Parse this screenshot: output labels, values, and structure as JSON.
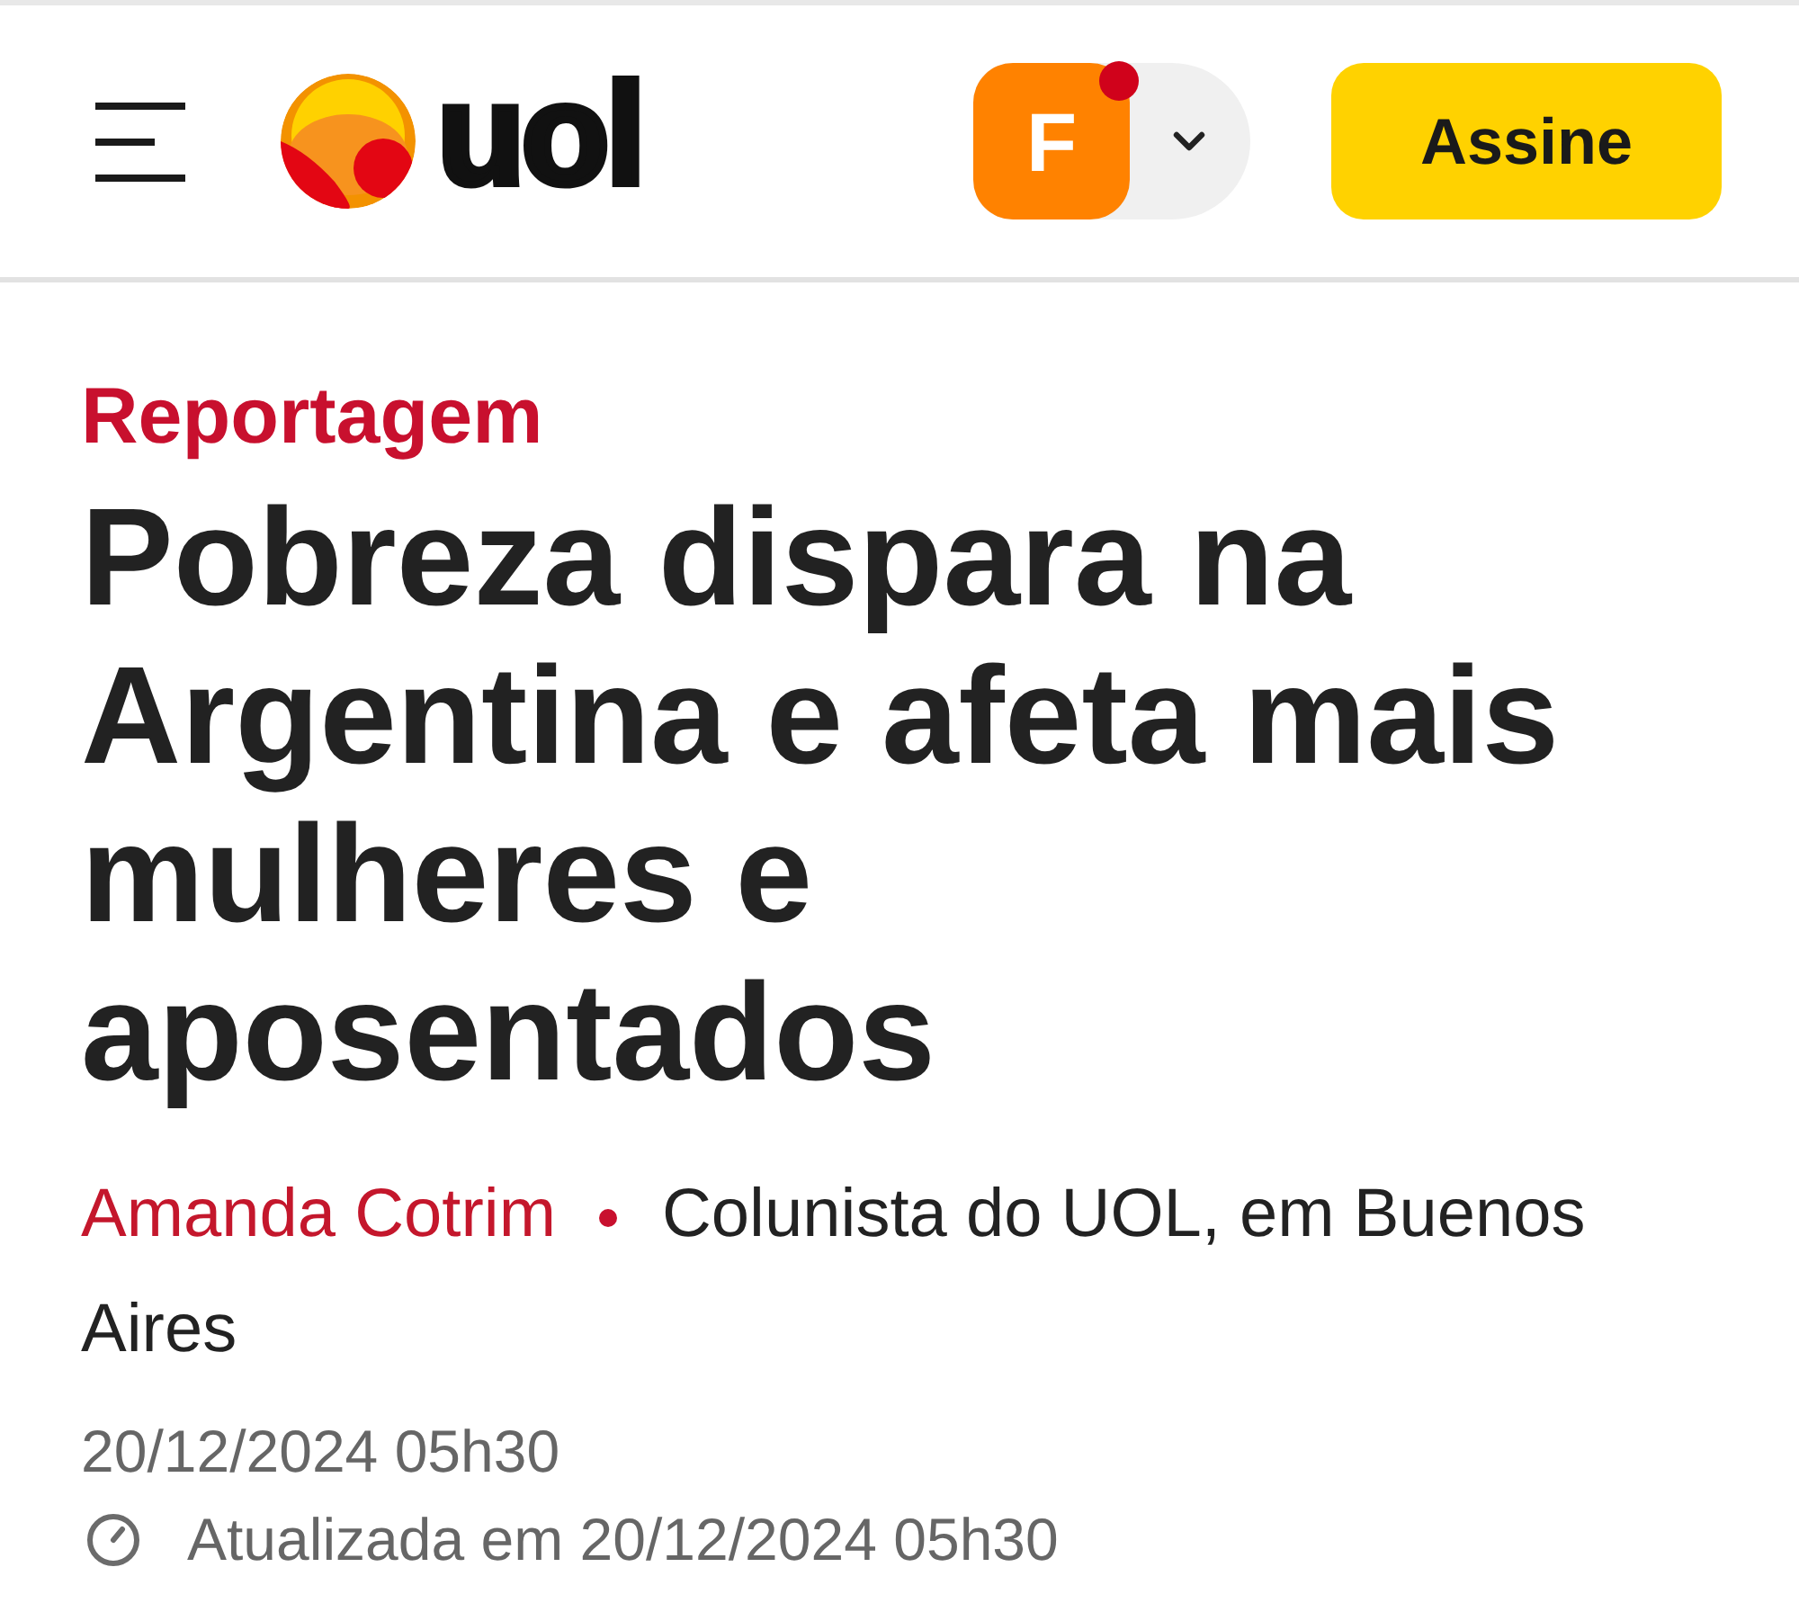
{
  "header": {
    "logo_text": "uol",
    "profile": {
      "initial": "F",
      "has_notification": true
    },
    "subscribe_button": "Assine"
  },
  "article": {
    "section": "Reportagem",
    "headline": "Pobreza dispara na Argentina e afeta mais mulheres e aposentados",
    "author": "Amanda Cotrim",
    "author_role": "Colunista do UOL, em Buenos Aires",
    "published": "20/12/2024 05h30",
    "updated": "Atualizada em 20/12/2024 05h30"
  }
}
